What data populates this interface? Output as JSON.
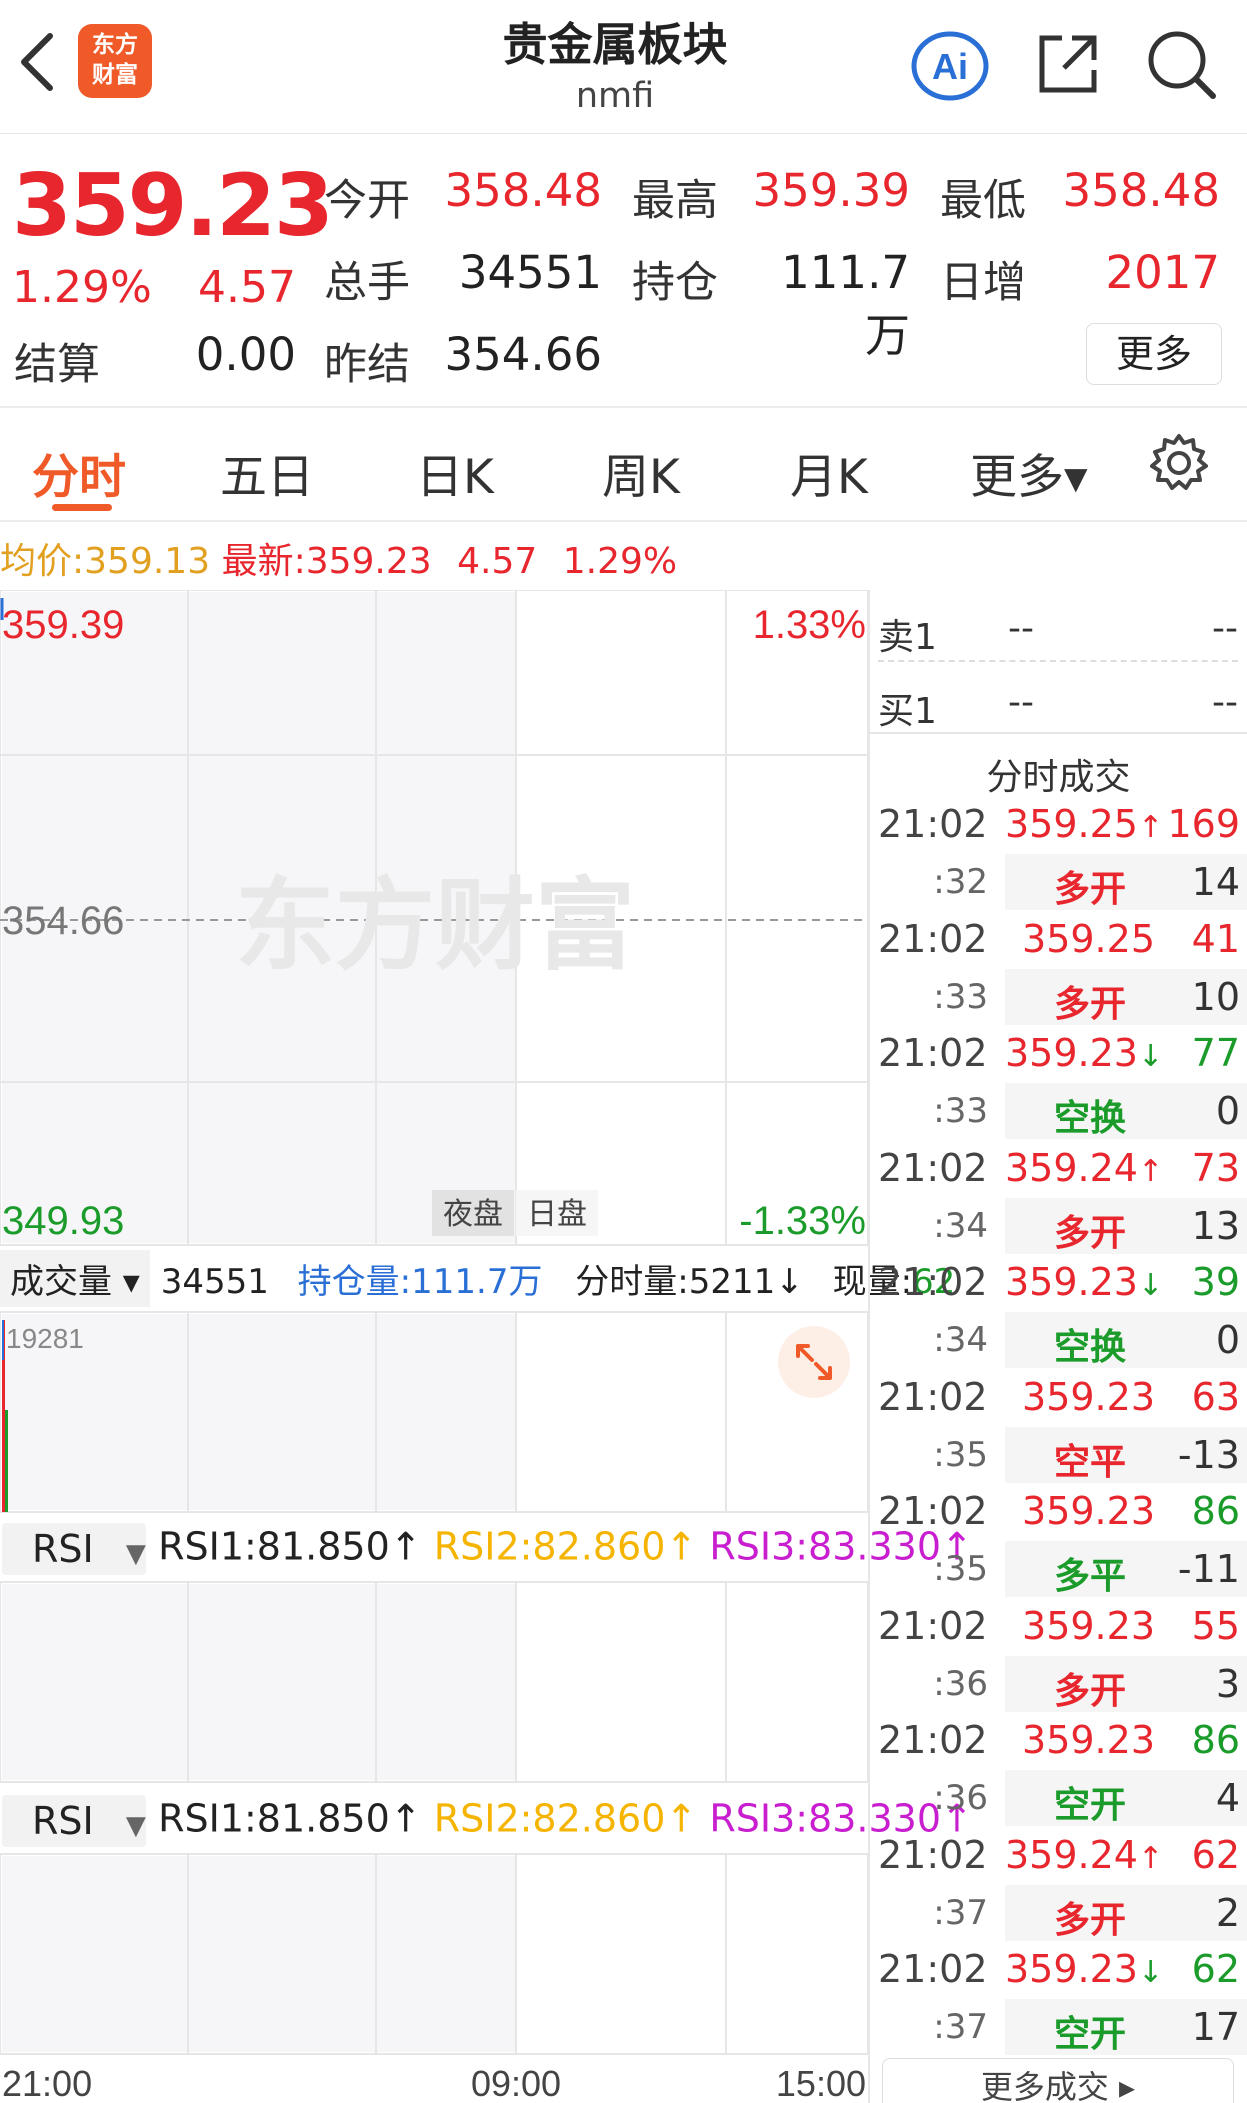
{
  "header": {
    "title": "贵金属板块",
    "code": "nmfi",
    "logo_line1": "东方",
    "logo_line2": "财富",
    "ai_label": "Ai"
  },
  "quote": {
    "price": "359.23",
    "change_pct": "1.29%",
    "change_val": "4.57",
    "open_label": "今开",
    "open": "358.48",
    "high_label": "最高",
    "high": "359.39",
    "low_label": "最低",
    "low": "358.48",
    "volume_label": "总手",
    "volume": "34551",
    "oi_label": "持仓",
    "oi": "111.7万",
    "daily_inc_label": "日增",
    "daily_inc": "2017",
    "settle_label": "结算",
    "settle": "0.00",
    "prev_settle_label": "昨结",
    "prev_settle": "354.66",
    "more_label": "更多"
  },
  "tabs": [
    "分时",
    "五日",
    "日K",
    "周K",
    "月K",
    "更多▾"
  ],
  "summary": {
    "avg_label": "均价:",
    "avg": "359.13",
    "latest_label": "最新:",
    "latest": "359.23",
    "change": "4.57",
    "pct": "1.29%"
  },
  "chart": {
    "top_price": "359.39",
    "mid_price": "354.66",
    "bottom_price": "349.93",
    "top_pct": "1.33%",
    "bottom_pct": "-1.33%",
    "watermark": "东方财富",
    "night_label": "夜盘",
    "day_label": "日盘",
    "times": [
      "21:00",
      "09:00",
      "15:00"
    ]
  },
  "volume_bar": {
    "selector": "成交量",
    "total": "34551",
    "oi_label": "持仓量:111.7万",
    "tick_label": "分时量:5211",
    "now_label": "现量:",
    "now_val": "62",
    "max_label": "19281"
  },
  "rsi": {
    "selector": "RSI",
    "rsi1": "RSI1:81.850",
    "rsi2": "RSI2:82.860",
    "rsi3": "RSI3:83.330"
  },
  "orderbook": {
    "sell_label": "卖1",
    "sell_price": "--",
    "sell_vol": "--",
    "buy_label": "买1",
    "buy_price": "--",
    "buy_vol": "--",
    "trades_title": "分时成交"
  },
  "trades": [
    {
      "time": "21:02",
      "sec": ":32",
      "price": "359.25",
      "arrow": "↑",
      "vol": "169",
      "vol_color": "red",
      "type": "多开",
      "type_color": "red",
      "qty": "14"
    },
    {
      "time": "21:02",
      "sec": ":33",
      "price": "359.25",
      "arrow": "",
      "vol": "41",
      "vol_color": "red",
      "type": "多开",
      "type_color": "red",
      "qty": "10"
    },
    {
      "time": "21:02",
      "sec": ":33",
      "price": "359.23",
      "arrow": "↓",
      "vol": "77",
      "vol_color": "green",
      "type": "空换",
      "type_color": "green",
      "qty": "0"
    },
    {
      "time": "21:02",
      "sec": ":34",
      "price": "359.24",
      "arrow": "↑",
      "vol": "73",
      "vol_color": "red",
      "type": "多开",
      "type_color": "red",
      "qty": "13"
    },
    {
      "time": "21:02",
      "sec": ":34",
      "price": "359.23",
      "arrow": "↓",
      "vol": "39",
      "vol_color": "green",
      "type": "空换",
      "type_color": "green",
      "qty": "0"
    },
    {
      "time": "21:02",
      "sec": ":35",
      "price": "359.23",
      "arrow": "",
      "vol": "63",
      "vol_color": "red",
      "type": "空平",
      "type_color": "red",
      "qty": "-13"
    },
    {
      "time": "21:02",
      "sec": ":35",
      "price": "359.23",
      "arrow": "",
      "vol": "86",
      "vol_color": "green",
      "type": "多平",
      "type_color": "green",
      "qty": "-11"
    },
    {
      "time": "21:02",
      "sec": ":36",
      "price": "359.23",
      "arrow": "",
      "vol": "55",
      "vol_color": "red",
      "type": "多开",
      "type_color": "red",
      "qty": "3"
    },
    {
      "time": "21:02",
      "sec": ":36",
      "price": "359.23",
      "arrow": "",
      "vol": "86",
      "vol_color": "green",
      "type": "空开",
      "type_color": "green",
      "qty": "4"
    },
    {
      "time": "21:02",
      "sec": ":37",
      "price": "359.24",
      "arrow": "↑",
      "vol": "62",
      "vol_color": "red",
      "type": "多开",
      "type_color": "red",
      "qty": "2"
    },
    {
      "time": "21:02",
      "sec": ":37",
      "price": "359.23",
      "arrow": "↓",
      "vol": "62",
      "vol_color": "green",
      "type": "空开",
      "type_color": "green",
      "qty": "17"
    }
  ],
  "more_trades_label": "更多成交 ▸",
  "colors": {
    "up": "#e8262e",
    "down": "#1a9b2a",
    "accent": "#f05a28",
    "avg": "#e2a021",
    "rsi3": "#c81ecf",
    "oi": "#2a6fd6"
  }
}
